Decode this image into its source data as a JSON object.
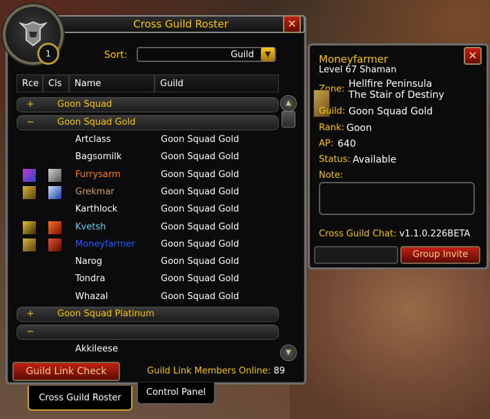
{
  "roster": {
    "title": "Cross Guild Roster",
    "badge_count": "1",
    "close_label": "✕",
    "sort": {
      "label": "Sort:",
      "value": "Guild"
    },
    "columns": [
      "Rce",
      "Cls",
      "Name",
      "Guild"
    ],
    "groups": [
      {
        "sign": "+",
        "name": "Goon Squad"
      },
      {
        "sign": "−",
        "name": "Goon Squad Gold"
      }
    ],
    "members": [
      {
        "name": "Artclass",
        "guild": "Goon Squad Gold",
        "name_color": "#ffffff",
        "race_icon": "",
        "class_icon": ""
      },
      {
        "name": "Bagsomilk",
        "guild": "Goon Squad Gold",
        "name_color": "#ffffff",
        "race_icon": "",
        "class_icon": ""
      },
      {
        "name": "Furrysarm",
        "guild": "Goon Squad Gold",
        "name_color": "#ff7d0a",
        "race_icon": "draenei-icon",
        "class_icon": "druid-icon"
      },
      {
        "name": "Grekmar",
        "guild": "Goon Squad Gold",
        "name_color": "#c79c6e",
        "race_icon": "dwarf-icon",
        "class_icon": "warrior-icon"
      },
      {
        "name": "Karthlock",
        "guild": "Goon Squad Gold",
        "name_color": "#ffffff",
        "race_icon": "",
        "class_icon": ""
      },
      {
        "name": "Kvetsh",
        "guild": "Goon Squad Gold",
        "name_color": "#69ccf0",
        "race_icon": "gnome-icon",
        "class_icon": "mage-icon"
      },
      {
        "name": "Moneyfarmer",
        "guild": "Goon Squad Gold",
        "name_color": "#2459ff",
        "race_icon": "dwarf-icon",
        "class_icon": "shaman-icon"
      },
      {
        "name": "Narog",
        "guild": "Goon Squad Gold",
        "name_color": "#ffffff",
        "race_icon": "",
        "class_icon": ""
      },
      {
        "name": "Tondra",
        "guild": "Goon Squad Gold",
        "name_color": "#ffffff",
        "race_icon": "",
        "class_icon": ""
      },
      {
        "name": "Whazal",
        "guild": "Goon Squad Gold",
        "name_color": "#ffffff",
        "race_icon": "",
        "class_icon": ""
      }
    ],
    "groups_after": [
      {
        "sign": "+",
        "name": "Goon Squad Platinum"
      },
      {
        "sign": "−",
        "name": ""
      }
    ],
    "trailing_member": {
      "name": "Akkileese"
    },
    "link_check_label": "Guild Link Check",
    "online_label": "Guild Link Members Online:",
    "online_count": "89",
    "tabs": [
      "Cross Guild Roster",
      "Control Panel"
    ]
  },
  "detail": {
    "name": "Moneyfarmer",
    "level_line": "Level 67 Shaman",
    "zone_label": "Zone:",
    "zone_line1": "Hellfire Peninsula",
    "zone_line2": "The Stair of Destiny",
    "guild_label": "Guild:",
    "guild_value": "Goon Squad Gold",
    "rank_label": "Rank:",
    "rank_value": "Goon",
    "ap_label": "AP:",
    "ap_value": "640",
    "status_label": "Status:",
    "status_value": "Available",
    "note_label": "Note:",
    "chat_label": "Cross Guild Chat:",
    "chat_version": "v1.1.0.226BETA",
    "group_invite_label": "Group Invite",
    "close_label": "✕"
  }
}
